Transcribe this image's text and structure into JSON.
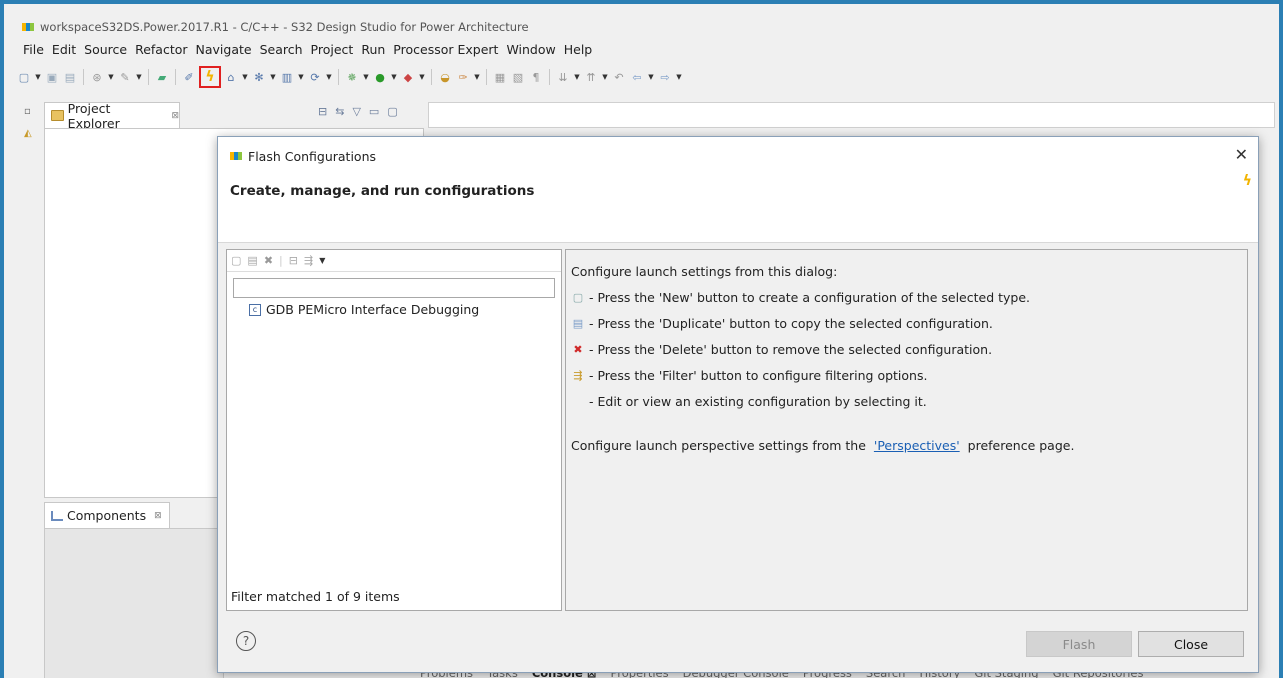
{
  "window": {
    "title": "workspaceS32DS.Power.2017.R1 - C/C++ - S32 Design Studio for Power Architecture"
  },
  "menu": [
    "File",
    "Edit",
    "Source",
    "Refactor",
    "Navigate",
    "Search",
    "Project",
    "Run",
    "Processor Expert",
    "Window",
    "Help"
  ],
  "toolbar": {
    "icons": [
      "new-icon",
      "save-icon",
      "save-all-icon",
      "build-icon",
      "tools-icon",
      "terminal-icon",
      "pen-icon",
      "flash-icon",
      "home-icon",
      "debug-icon",
      "run-icon",
      "external-tools-icon",
      "nav-back-icon",
      "nav-forward-icon"
    ],
    "highlighted": "flash-icon"
  },
  "views": {
    "project_explorer": {
      "label": "Project Explorer",
      "close": "⊠"
    },
    "components": {
      "label": "Components",
      "close": "⊠"
    }
  },
  "bottom_tabs": [
    "Problems",
    "Tasks",
    "Console ⊠",
    "Properties",
    "Debugger Console",
    "Progress",
    "Search",
    "History",
    "Git Staging",
    "Git Repositories"
  ],
  "dialog": {
    "title": "Flash Configurations",
    "heading": "Create, manage, and run configurations",
    "filter_placeholder": "",
    "tree": [
      {
        "label": "GDB PEMicro Interface Debugging"
      }
    ],
    "filter_status": "Filter matched 1 of 9 items",
    "instructions": {
      "intro": "Configure launch settings from this dialog:",
      "lines": [
        {
          "icon": "new-config-icon",
          "text": "- Press the 'New' button to create a configuration of the selected type."
        },
        {
          "icon": "duplicate-icon",
          "text": "- Press the 'Duplicate' button to copy the selected configuration."
        },
        {
          "icon": "delete-icon",
          "text": "- Press the 'Delete' button to remove the selected configuration."
        },
        {
          "icon": "filter-icon",
          "text": "- Press the 'Filter' button to configure filtering options."
        },
        {
          "icon": "",
          "text": "- Edit or view an existing configuration by selecting it."
        }
      ],
      "perspective_prefix": "Configure launch perspective settings from the ",
      "perspective_link": "'Perspectives'",
      "perspective_suffix": " preference page."
    },
    "buttons": {
      "flash": "Flash",
      "close": "Close"
    }
  }
}
